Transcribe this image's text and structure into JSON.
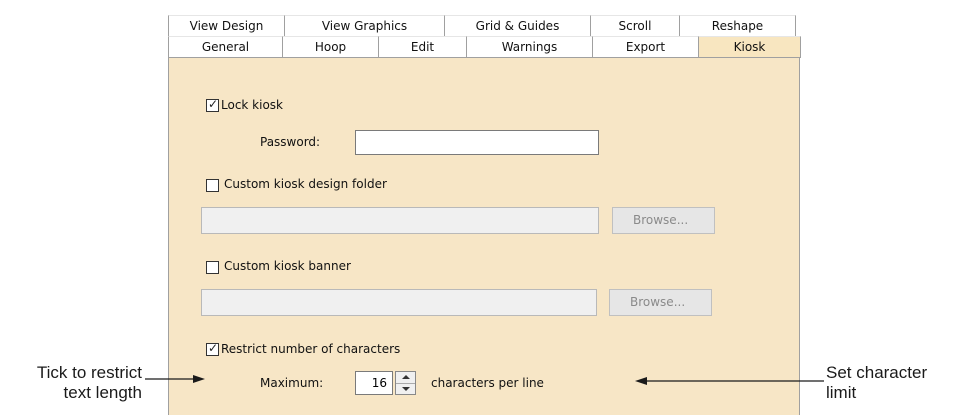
{
  "tabs_row1": [
    "View Design",
    "View Graphics",
    "Grid & Guides",
    "Scroll",
    "Reshape"
  ],
  "tabs_row2": [
    "General",
    "Hoop",
    "Edit",
    "Warnings",
    "Export",
    "Kiosk"
  ],
  "active_tab": "Kiosk",
  "lock_kiosk": {
    "label": "Lock kiosk",
    "checked": true
  },
  "password": {
    "label": "Password:",
    "value": ""
  },
  "design_folder": {
    "label": "Custom kiosk design folder",
    "checked": false,
    "value": "",
    "browse_label": "Browse..."
  },
  "banner": {
    "label": "Custom kiosk banner",
    "checked": false,
    "value": "",
    "browse_label": "Browse..."
  },
  "restrict": {
    "label": "Restrict number of characters",
    "checked": true
  },
  "maximum": {
    "label": "Maximum:",
    "value": "16",
    "suffix": "characters per line"
  },
  "callouts": {
    "left": [
      "Tick to restrict",
      "text length"
    ],
    "right": [
      "Set character",
      "limit"
    ]
  },
  "colors": {
    "panel_bg": "#f7e6c6",
    "active_tab_bg": "#f8e6c0"
  },
  "icons": [
    "checkmark-icon",
    "spin-up-icon",
    "spin-down-icon",
    "arrow-right-icon",
    "arrow-left-icon"
  ]
}
